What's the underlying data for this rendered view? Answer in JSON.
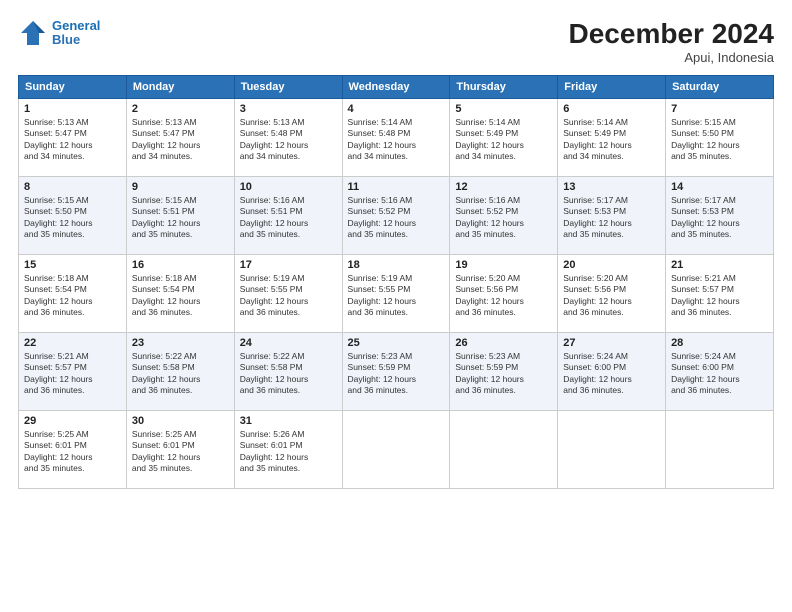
{
  "header": {
    "logo_line1": "General",
    "logo_line2": "Blue",
    "title": "December 2024",
    "subtitle": "Apui, Indonesia"
  },
  "days_of_week": [
    "Sunday",
    "Monday",
    "Tuesday",
    "Wednesday",
    "Thursday",
    "Friday",
    "Saturday"
  ],
  "weeks": [
    [
      {
        "day": "1",
        "info": "Sunrise: 5:13 AM\nSunset: 5:47 PM\nDaylight: 12 hours\nand 34 minutes."
      },
      {
        "day": "2",
        "info": "Sunrise: 5:13 AM\nSunset: 5:47 PM\nDaylight: 12 hours\nand 34 minutes."
      },
      {
        "day": "3",
        "info": "Sunrise: 5:13 AM\nSunset: 5:48 PM\nDaylight: 12 hours\nand 34 minutes."
      },
      {
        "day": "4",
        "info": "Sunrise: 5:14 AM\nSunset: 5:48 PM\nDaylight: 12 hours\nand 34 minutes."
      },
      {
        "day": "5",
        "info": "Sunrise: 5:14 AM\nSunset: 5:49 PM\nDaylight: 12 hours\nand 34 minutes."
      },
      {
        "day": "6",
        "info": "Sunrise: 5:14 AM\nSunset: 5:49 PM\nDaylight: 12 hours\nand 34 minutes."
      },
      {
        "day": "7",
        "info": "Sunrise: 5:15 AM\nSunset: 5:50 PM\nDaylight: 12 hours\nand 35 minutes."
      }
    ],
    [
      {
        "day": "8",
        "info": "Sunrise: 5:15 AM\nSunset: 5:50 PM\nDaylight: 12 hours\nand 35 minutes."
      },
      {
        "day": "9",
        "info": "Sunrise: 5:15 AM\nSunset: 5:51 PM\nDaylight: 12 hours\nand 35 minutes."
      },
      {
        "day": "10",
        "info": "Sunrise: 5:16 AM\nSunset: 5:51 PM\nDaylight: 12 hours\nand 35 minutes."
      },
      {
        "day": "11",
        "info": "Sunrise: 5:16 AM\nSunset: 5:52 PM\nDaylight: 12 hours\nand 35 minutes."
      },
      {
        "day": "12",
        "info": "Sunrise: 5:16 AM\nSunset: 5:52 PM\nDaylight: 12 hours\nand 35 minutes."
      },
      {
        "day": "13",
        "info": "Sunrise: 5:17 AM\nSunset: 5:53 PM\nDaylight: 12 hours\nand 35 minutes."
      },
      {
        "day": "14",
        "info": "Sunrise: 5:17 AM\nSunset: 5:53 PM\nDaylight: 12 hours\nand 35 minutes."
      }
    ],
    [
      {
        "day": "15",
        "info": "Sunrise: 5:18 AM\nSunset: 5:54 PM\nDaylight: 12 hours\nand 36 minutes."
      },
      {
        "day": "16",
        "info": "Sunrise: 5:18 AM\nSunset: 5:54 PM\nDaylight: 12 hours\nand 36 minutes."
      },
      {
        "day": "17",
        "info": "Sunrise: 5:19 AM\nSunset: 5:55 PM\nDaylight: 12 hours\nand 36 minutes."
      },
      {
        "day": "18",
        "info": "Sunrise: 5:19 AM\nSunset: 5:55 PM\nDaylight: 12 hours\nand 36 minutes."
      },
      {
        "day": "19",
        "info": "Sunrise: 5:20 AM\nSunset: 5:56 PM\nDaylight: 12 hours\nand 36 minutes."
      },
      {
        "day": "20",
        "info": "Sunrise: 5:20 AM\nSunset: 5:56 PM\nDaylight: 12 hours\nand 36 minutes."
      },
      {
        "day": "21",
        "info": "Sunrise: 5:21 AM\nSunset: 5:57 PM\nDaylight: 12 hours\nand 36 minutes."
      }
    ],
    [
      {
        "day": "22",
        "info": "Sunrise: 5:21 AM\nSunset: 5:57 PM\nDaylight: 12 hours\nand 36 minutes."
      },
      {
        "day": "23",
        "info": "Sunrise: 5:22 AM\nSunset: 5:58 PM\nDaylight: 12 hours\nand 36 minutes."
      },
      {
        "day": "24",
        "info": "Sunrise: 5:22 AM\nSunset: 5:58 PM\nDaylight: 12 hours\nand 36 minutes."
      },
      {
        "day": "25",
        "info": "Sunrise: 5:23 AM\nSunset: 5:59 PM\nDaylight: 12 hours\nand 36 minutes."
      },
      {
        "day": "26",
        "info": "Sunrise: 5:23 AM\nSunset: 5:59 PM\nDaylight: 12 hours\nand 36 minutes."
      },
      {
        "day": "27",
        "info": "Sunrise: 5:24 AM\nSunset: 6:00 PM\nDaylight: 12 hours\nand 36 minutes."
      },
      {
        "day": "28",
        "info": "Sunrise: 5:24 AM\nSunset: 6:00 PM\nDaylight: 12 hours\nand 36 minutes."
      }
    ],
    [
      {
        "day": "29",
        "info": "Sunrise: 5:25 AM\nSunset: 6:01 PM\nDaylight: 12 hours\nand 35 minutes."
      },
      {
        "day": "30",
        "info": "Sunrise: 5:25 AM\nSunset: 6:01 PM\nDaylight: 12 hours\nand 35 minutes."
      },
      {
        "day": "31",
        "info": "Sunrise: 5:26 AM\nSunset: 6:01 PM\nDaylight: 12 hours\nand 35 minutes."
      },
      null,
      null,
      null,
      null
    ]
  ]
}
